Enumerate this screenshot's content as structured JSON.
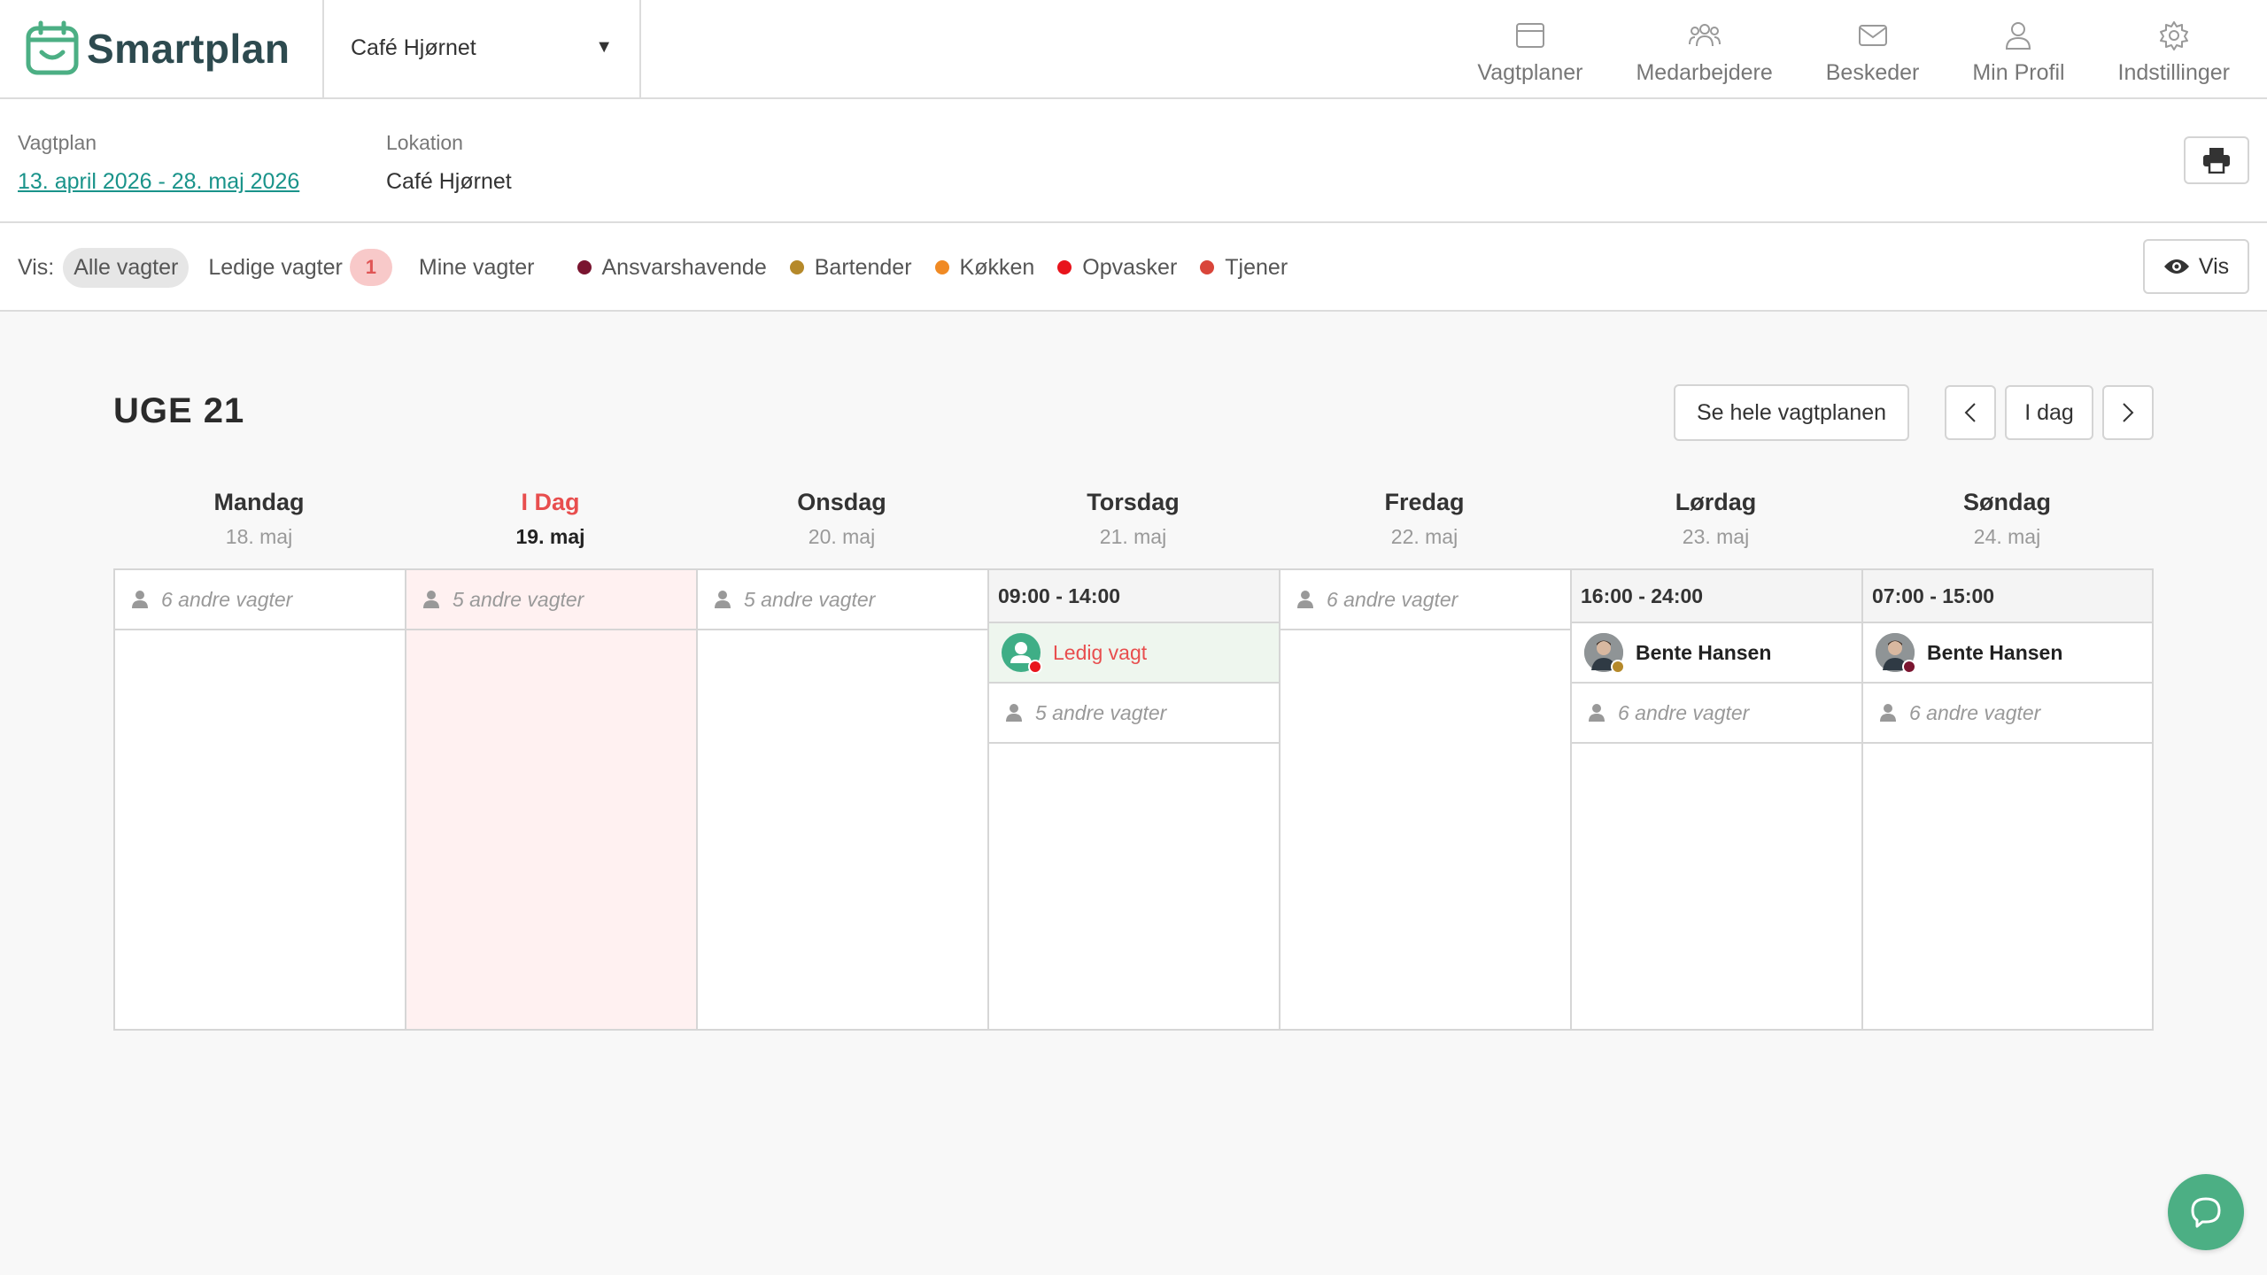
{
  "header": {
    "brand": "Smartplan",
    "location_select": "Café Hjørnet",
    "nav": [
      {
        "label": "Vagtplaner",
        "icon": "calendar-icon"
      },
      {
        "label": "Medarbejdere",
        "icon": "users-icon"
      },
      {
        "label": "Beskeder",
        "icon": "envelope-icon"
      },
      {
        "label": "Min Profil",
        "icon": "user-icon"
      },
      {
        "label": "Indstillinger",
        "icon": "gear-icon"
      }
    ]
  },
  "info": {
    "schedule_label": "Vagtplan",
    "schedule_value": "13. april 2026 - 28. maj 2026",
    "location_label": "Lokation",
    "location_value": "Café Hjørnet",
    "print_icon": "printer-icon"
  },
  "filter": {
    "label": "Vis:",
    "options": [
      "Alle vagter",
      "Ledige vagter",
      "Mine vagter"
    ],
    "active": "Alle vagter",
    "free_count": "1",
    "legend": [
      {
        "label": "Ansvarshavende",
        "color": "#7a1530"
      },
      {
        "label": "Bartender",
        "color": "#b5892a"
      },
      {
        "label": "Køkken",
        "color": "#f08a24"
      },
      {
        "label": "Opvasker",
        "color": "#e8141c"
      },
      {
        "label": "Tjener",
        "color": "#d9453a"
      }
    ],
    "vis_button": "Vis"
  },
  "week": {
    "title": "UGE 21",
    "see_all": "Se hele vagtplanen",
    "today_button": "I dag",
    "days": [
      {
        "name": "Mandag",
        "date": "18. maj",
        "today": false
      },
      {
        "name": "I Dag",
        "date": "19. maj",
        "today": true
      },
      {
        "name": "Onsdag",
        "date": "20. maj",
        "today": false
      },
      {
        "name": "Torsdag",
        "date": "21. maj",
        "today": false
      },
      {
        "name": "Fredag",
        "date": "22. maj",
        "today": false
      },
      {
        "name": "Lørdag",
        "date": "23. maj",
        "today": false
      },
      {
        "name": "Søndag",
        "date": "24. maj",
        "today": false
      }
    ]
  },
  "calendar": {
    "mon_others": "6 andre vagter",
    "tue_others": "5 andre vagter",
    "wed_others": "5 andre vagter",
    "thu_time": "09:00 - 14:00",
    "thu_person": "Ledig vagt",
    "thu_others": "5 andre vagter",
    "fri_others": "6 andre vagter",
    "sat_time": "16:00 - 24:00",
    "sat_person": "Bente Hansen",
    "sat_others": "6 andre vagter",
    "sun_time": "07:00 - 15:00",
    "sun_person": "Bente Hansen",
    "sun_others": "6 andre vagter"
  }
}
